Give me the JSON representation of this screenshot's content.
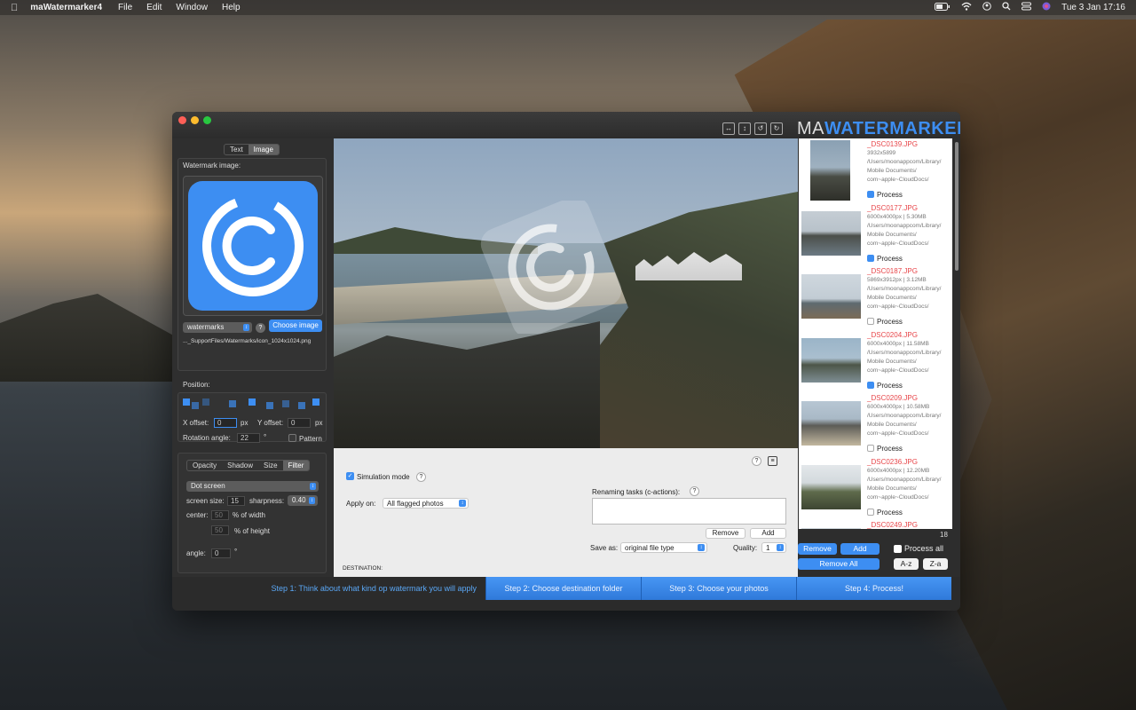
{
  "menubar": {
    "app_name": "maWatermarker4",
    "items": [
      "File",
      "Edit",
      "Window",
      "Help"
    ],
    "clock": "Tue 3 Jan  17:16"
  },
  "window": {
    "logo_ma": "MA",
    "logo_watermarker": "WATERMARKER"
  },
  "left": {
    "tabs": [
      "Text",
      "Image"
    ],
    "active_tab": "Image",
    "watermark_image_label": "Watermark image:",
    "collection_select": "watermarks",
    "choose_image": "Choose image",
    "file_path": "..._SupportFiles/Watermarks/icon_1024x1024.png",
    "position_label": "Position:",
    "x_offset_label": "X offset:",
    "x_offset_value": "0",
    "y_offset_label": "Y offset:",
    "y_offset_value": "0",
    "unit_px": "px",
    "rotation_label": "Rotation angle:",
    "rotation_value": "22",
    "degree": "°",
    "pattern_label": "Pattern",
    "effect_tabs": [
      "Opacity",
      "Shadow",
      "Size",
      "Filter"
    ],
    "active_effect_tab": "Filter",
    "filter_select": "Dot screen",
    "screen_size_label": "screen size:",
    "screen_size_value": "15",
    "sharpness_label": "sharpness:",
    "sharpness_value": "0.40",
    "center_label": "center:",
    "center_x_value": "50",
    "pct_width": "% of width",
    "center_y_value": "50",
    "pct_height": "% of height",
    "angle_label": "angle:",
    "angle_value": "0"
  },
  "bottom": {
    "simulation_label": "Simulation mode",
    "apply_on_label": "Apply on:",
    "apply_on_value": "All flagged photos",
    "renaming_label": "Renaming tasks (c-actions):",
    "remove": "Remove",
    "add": "Add",
    "save_as_label": "Save as:",
    "save_as_value": "original file type",
    "quality_label": "Quality:",
    "quality_value": "1",
    "destination_label": "DESTINATION:"
  },
  "photos": [
    {
      "name": "_DSC0139.JPG",
      "meta1": "3932x5899",
      "path1": "/Users/moonappcom/Library/",
      "path2": "Mobile Documents/",
      "path3": "com~apple~CloudDocs/",
      "process": true
    },
    {
      "name": "_DSC0177.JPG",
      "meta1": "6000x4000px | 5.30MB",
      "path1": "/Users/moonappcom/Library/",
      "path2": "Mobile Documents/",
      "path3": "com~apple~CloudDocs/",
      "process": true
    },
    {
      "name": "_DSC0187.JPG",
      "meta1": "5869x3912px | 3.12MB",
      "path1": "/Users/moonappcom/Library/",
      "path2": "Mobile Documents/",
      "path3": "com~apple~CloudDocs/",
      "process": false
    },
    {
      "name": "_DSC0204.JPG",
      "meta1": "6000x4000px | 11.58MB",
      "path1": "/Users/moonappcom/Library/",
      "path2": "Mobile Documents/",
      "path3": "com~apple~CloudDocs/",
      "process": true
    },
    {
      "name": "_DSC0209.JPG",
      "meta1": "6000x4000px | 10.58MB",
      "path1": "/Users/moonappcom/Library/",
      "path2": "Mobile Documents/",
      "path3": "com~apple~CloudDocs/",
      "process": false
    },
    {
      "name": "_DSC0236.JPG",
      "meta1": "6000x4000px | 12.20MB",
      "path1": "/Users/moonappcom/Library/",
      "path2": "Mobile Documents/",
      "path3": "com~apple~CloudDocs/",
      "process": false
    },
    {
      "name": "_DSC0249.JPG"
    }
  ],
  "process_label": "Process",
  "right": {
    "count": "18",
    "remove": "Remove",
    "add": "Add",
    "process_all": "Process all",
    "remove_all": "Remove All",
    "sort_az": "A-z",
    "sort_za": "Z-a"
  },
  "steps": {
    "s1": "Step 1: Think about what kind op watermark you will apply",
    "s2": "Step 2: Choose destination folder",
    "s3": "Step 3: Choose your photos",
    "s4": "Step 4: Process!"
  },
  "colors": {
    "accent": "#3d8ef2",
    "filename": "#e8464a"
  }
}
